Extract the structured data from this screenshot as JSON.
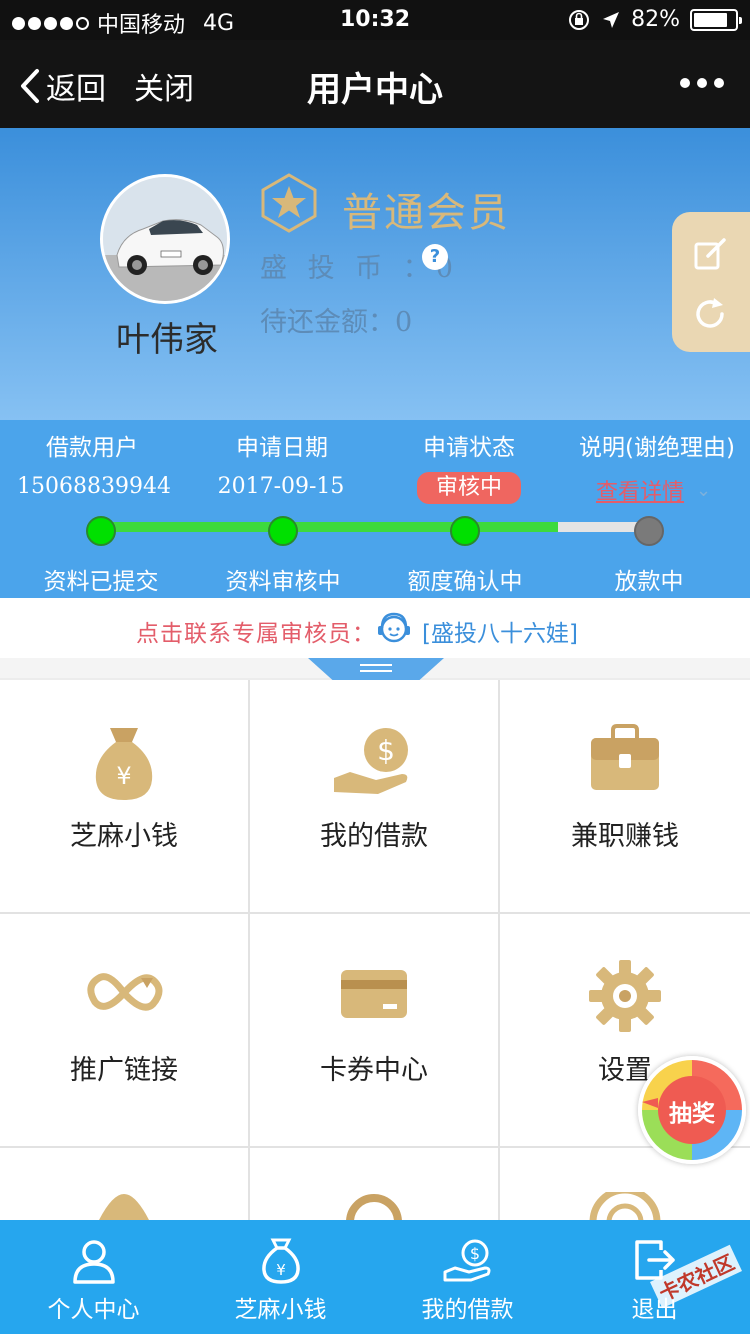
{
  "status_bar": {
    "carrier": "中国移动",
    "network": "4G",
    "time": "10:32",
    "battery": "82%",
    "battery_level": 0.82
  },
  "nav": {
    "back_label": "返回",
    "close_label": "关闭",
    "title": "用户中心"
  },
  "profile": {
    "name": "叶伟家",
    "member_level": "普通会员",
    "coins_label": "盛 投 币 ：",
    "coins_value": "0",
    "due_label": "待还金额：",
    "due_value": "0"
  },
  "application": {
    "headers": [
      "借款用户",
      "申请日期",
      "申请状态",
      "说明(谢绝理由)"
    ],
    "user": "15068839944",
    "date": "2017-09-15",
    "status": "审核中",
    "detail_link": "查看详情",
    "progress_steps": [
      "资料已提交",
      "资料审核中",
      "额度确认中",
      "放款中"
    ],
    "completed_steps": 3
  },
  "reviewer": {
    "label": "点击联系专属审核员：",
    "name": "[盛投八十六娃]"
  },
  "grid_items": [
    {
      "label": "芝麻小钱",
      "icon": "money-bag-icon"
    },
    {
      "label": "我的借款",
      "icon": "hand-coin-icon"
    },
    {
      "label": "兼职赚钱",
      "icon": "briefcase-icon"
    },
    {
      "label": "推广链接",
      "icon": "link-icon"
    },
    {
      "label": "卡券中心",
      "icon": "card-icon"
    },
    {
      "label": "设置",
      "icon": "gear-icon"
    }
  ],
  "lottery": {
    "label": "抽奖"
  },
  "tabs": [
    {
      "label": "个人中心",
      "icon": "person-icon"
    },
    {
      "label": "芝麻小钱",
      "icon": "money-bag-icon"
    },
    {
      "label": "我的借款",
      "icon": "hand-coin-icon"
    },
    {
      "label": "退出",
      "icon": "logout-icon"
    }
  ],
  "watermark": "卡农社区",
  "colors": {
    "primary": "#26a6ee",
    "gold": "#d8b87a",
    "alert": "#ef6660",
    "progress": "#3dda3d"
  }
}
